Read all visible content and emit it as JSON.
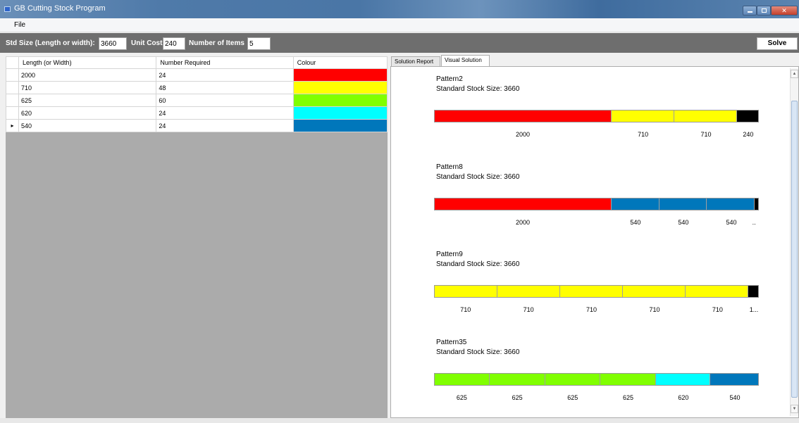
{
  "window": {
    "title": "GB Cutting Stock Program",
    "minimize_glyph": "",
    "maximize_glyph": "",
    "close_glyph": "✕"
  },
  "menu": {
    "file": "File"
  },
  "toolbar": {
    "std_size_label": "Std Size (Length or width):",
    "std_size_value": "3660",
    "unit_cost_label": "Unit Cost",
    "unit_cost_value": "240",
    "num_items_label": "Number of Items",
    "num_items_value": "5",
    "solve_label": "Solve"
  },
  "grid": {
    "headers": [
      "Length (or Width)",
      "Number Required",
      "Colour"
    ],
    "current_row_marker": "▸",
    "rows": [
      {
        "length": "2000",
        "required": "24",
        "colour": "#ff0000"
      },
      {
        "length": "710",
        "required": "48",
        "colour": "#ffff00"
      },
      {
        "length": "625",
        "required": "60",
        "colour": "#80ff00"
      },
      {
        "length": "620",
        "required": "24",
        "colour": "#00ffff"
      },
      {
        "length": "540",
        "required": "24",
        "colour": "#0077bb"
      }
    ],
    "current_row_index": 4
  },
  "tabs": [
    {
      "label": "Solution Report",
      "active": false
    },
    {
      "label": "Visual Solution",
      "active": true
    }
  ],
  "patterns": [
    {
      "name": "Pattern2",
      "stock_text": "Standard Stock Size: 3660",
      "segments": [
        {
          "length": 2000,
          "label": "2000",
          "colour": "#ff0000"
        },
        {
          "length": 710,
          "label": "710",
          "colour": "#ffff00"
        },
        {
          "length": 710,
          "label": "710",
          "colour": "#ffff00"
        },
        {
          "length": 240,
          "label": "240",
          "colour": "#000000"
        }
      ]
    },
    {
      "name": "Pattern8",
      "stock_text": "Standard Stock Size: 3660",
      "segments": [
        {
          "length": 2000,
          "label": "2000",
          "colour": "#ff0000"
        },
        {
          "length": 540,
          "label": "540",
          "colour": "#0077bb"
        },
        {
          "length": 540,
          "label": "540",
          "colour": "#0077bb"
        },
        {
          "length": 540,
          "label": "540",
          "colour": "#0077bb"
        },
        {
          "length": 40,
          "label": "..",
          "colour": "#000000"
        }
      ]
    },
    {
      "name": "Pattern9",
      "stock_text": "Standard Stock Size: 3660",
      "segments": [
        {
          "length": 710,
          "label": "710",
          "colour": "#ffff00"
        },
        {
          "length": 710,
          "label": "710",
          "colour": "#ffff00"
        },
        {
          "length": 710,
          "label": "710",
          "colour": "#ffff00"
        },
        {
          "length": 710,
          "label": "710",
          "colour": "#ffff00"
        },
        {
          "length": 710,
          "label": "710",
          "colour": "#ffff00"
        },
        {
          "length": 110,
          "label": "1...",
          "colour": "#000000"
        }
      ]
    },
    {
      "name": "Pattern35",
      "stock_text": "Standard Stock Size: 3660",
      "segments": [
        {
          "length": 625,
          "label": "625",
          "colour": "#80ff00"
        },
        {
          "length": 625,
          "label": "625",
          "colour": "#80ff00"
        },
        {
          "length": 625,
          "label": "625",
          "colour": "#80ff00"
        },
        {
          "length": 625,
          "label": "625",
          "colour": "#80ff00"
        },
        {
          "length": 620,
          "label": "620",
          "colour": "#00ffff"
        },
        {
          "length": 540,
          "label": "540",
          "colour": "#0077bb"
        }
      ]
    }
  ],
  "scrollbar": {
    "up_glyph": "▲",
    "down_glyph": "▼"
  }
}
